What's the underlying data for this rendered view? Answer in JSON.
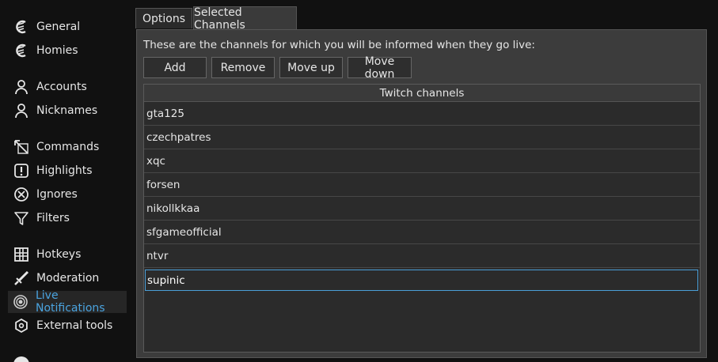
{
  "sidebar": {
    "items": [
      {
        "label": "General",
        "icon": "chatterino-icon"
      },
      {
        "label": "Homies",
        "icon": "chatterino-icon"
      },
      {
        "label": "Accounts",
        "icon": "user-icon"
      },
      {
        "label": "Nicknames",
        "icon": "user-icon"
      },
      {
        "label": "Commands",
        "icon": "commands-icon"
      },
      {
        "label": "Highlights",
        "icon": "exclamation-icon"
      },
      {
        "label": "Ignores",
        "icon": "block-icon"
      },
      {
        "label": "Filters",
        "icon": "filter-icon"
      },
      {
        "label": "Hotkeys",
        "icon": "hotkeys-icon"
      },
      {
        "label": "Moderation",
        "icon": "sword-icon"
      },
      {
        "label": "Live Notifications",
        "icon": "live-icon",
        "active": true
      },
      {
        "label": "External tools",
        "icon": "gear-icon"
      }
    ]
  },
  "tabs": [
    {
      "label": "Options"
    },
    {
      "label": "Selected Channels",
      "active": true
    }
  ],
  "panel": {
    "description": "These are the channels for which you will be informed when they go live:",
    "buttons": {
      "add": "Add",
      "remove": "Remove",
      "move_up": "Move up",
      "move_down": "Move down"
    },
    "table": {
      "header": "Twitch channels",
      "rows": [
        "gta125",
        "czechpatres",
        "xqc",
        "forsen",
        "nikollkkaa",
        "sfgameofficial",
        "ntvr"
      ],
      "editing_value": "supinic"
    }
  },
  "colors": {
    "background": "#111111",
    "panel": "#3c3c3c",
    "accent": "#4aa3df"
  }
}
